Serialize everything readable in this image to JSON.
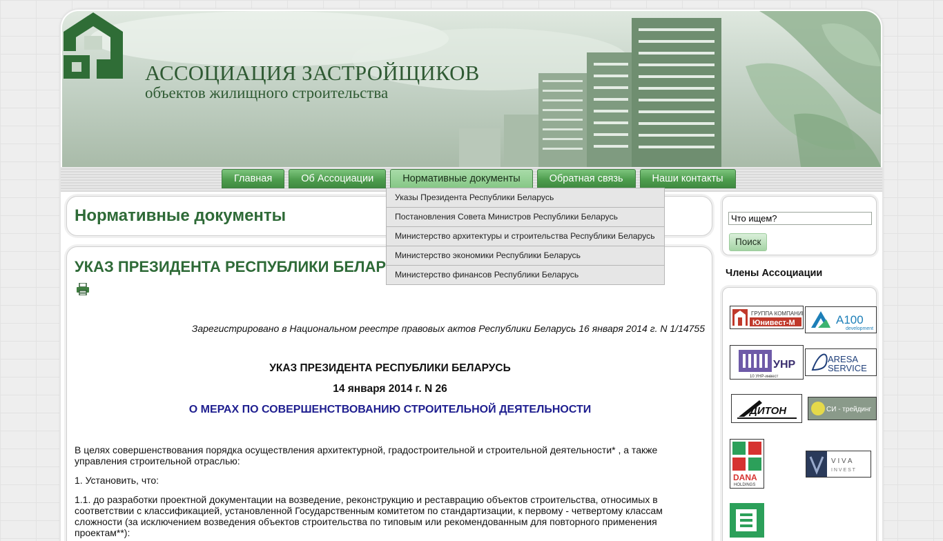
{
  "header": {
    "title_line1": "АССОЦИАЦИЯ ЗАСТРОЙЩИКОВ",
    "title_line2": "объектов жилищного строительства"
  },
  "nav": {
    "items": [
      {
        "label": "Главная"
      },
      {
        "label": "Об Ассоциации"
      },
      {
        "label": "Нормативные документы"
      },
      {
        "label": "Обратная связь"
      },
      {
        "label": "Наши контакты"
      }
    ],
    "active_index": 2
  },
  "dropdown": {
    "items": [
      {
        "label": "Указы Президента Республики Беларусь"
      },
      {
        "label": "Постановления Совета Министров Республики Беларусь"
      },
      {
        "label": "Министерство архитектуры и строительства Республики Беларусь"
      },
      {
        "label": "Министерство экономики Республики Беларусь"
      },
      {
        "label": "Министерство финансов Республики Беларусь"
      }
    ]
  },
  "page": {
    "title": "Нормативные документы"
  },
  "document": {
    "title": "УКАЗ ПРЕЗИДЕНТА РЕСПУБЛИКИ БЕЛАРУСЬ",
    "registration": "Зарегистрировано в Национальном реестре правовых актов Республики Беларусь 16 января 2014 г. N 1/14755",
    "heading": "УКАЗ ПРЕЗИДЕНТА РЕСПУБЛИКИ БЕЛАРУСЬ",
    "date_number": "14 января 2014 г. N 26",
    "subject": "О МЕРАХ ПО СОВЕРШЕНСТВОВАНИЮ СТРОИТЕЛЬНОЙ ДЕЯТЕЛЬНОСТИ",
    "paragraphs": [
      "В целях совершенствования порядка осуществления архитектурной, градостроительной и строительной деятельности* , а также управления строительной отраслью:",
      "1. Установить, что:",
      "1.1. до разработки проектной документации на возведение, реконструкцию и реставрацию объектов строительства, относимых в соответствии с классификацией, установленной Государственным комитетом по стандартизации, к первому - четвертому классам сложности (за исключением возведения объектов строительства по типовым или рекомендованным для повторного применения проектам**):"
    ]
  },
  "sidebar": {
    "search_value": "Что ищем?",
    "search_button": "Поиск",
    "members_title": "Члены Ассоциации",
    "members": [
      {
        "name": "ГРУППА КОМПАНИЙ Юнивест-М",
        "line1": "ГРУППА КОМПАНИЙ",
        "line2": "Юнивест-М"
      },
      {
        "name": "A100 development",
        "line1": "A100",
        "line2": "development"
      },
      {
        "name": "10 УНР-инвест",
        "line1": "УНР",
        "line2": "10 УНР-инвест"
      },
      {
        "name": "ARESA SERVICE",
        "line1": "ARESA",
        "line2": "SERVICE"
      },
      {
        "name": "Дитон",
        "line1": "ДИТОН"
      },
      {
        "name": "СИ-трейдинг",
        "line1": "СИ - трейдинг"
      },
      {
        "name": "DANA HOLDINGS",
        "line1": "DANA",
        "line2": "HOLDINGS"
      },
      {
        "name": "VIVA INVEST",
        "line1": "V I V A",
        "line2": "I N V E S T"
      }
    ]
  },
  "colors": {
    "accent_green": "#2e6a37",
    "nav_green": "#4e9d4e",
    "subject_blue": "#1e1e8f"
  }
}
